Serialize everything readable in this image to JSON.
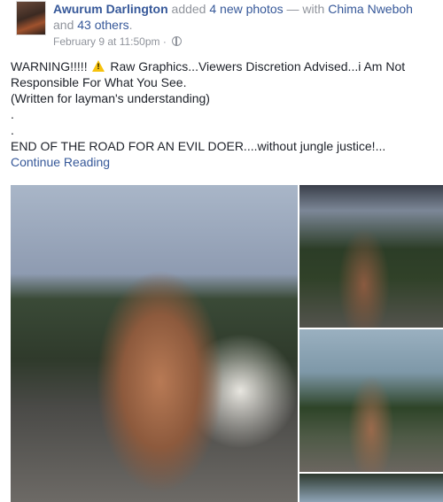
{
  "header": {
    "author": "Awurum Darlington",
    "action_prefix": " added ",
    "photos_link": "4 new photos",
    "with_text": " — with ",
    "tagged": "Chima Nweboh",
    "and_text": " and ",
    "others": "43 others",
    "period": ".",
    "timestamp": "February 9 at 11:50pm",
    "separator": " · "
  },
  "post": {
    "line1_before_icon": "WARNING!!!!! ",
    "line1_after_icon": " Raw Graphics...Viewers Discretion Advised...i Am Not Responsible For What You See.",
    "line2": "(Written for layman's understanding)",
    "dot1": ".",
    "dot2": ".",
    "line3": "END OF THE ROAD FOR AN EVIL DOER....without jungle justice!...",
    "continue": "Continue Reading"
  },
  "icons": {
    "globe": "globe-icon",
    "warning": "warning-icon"
  }
}
